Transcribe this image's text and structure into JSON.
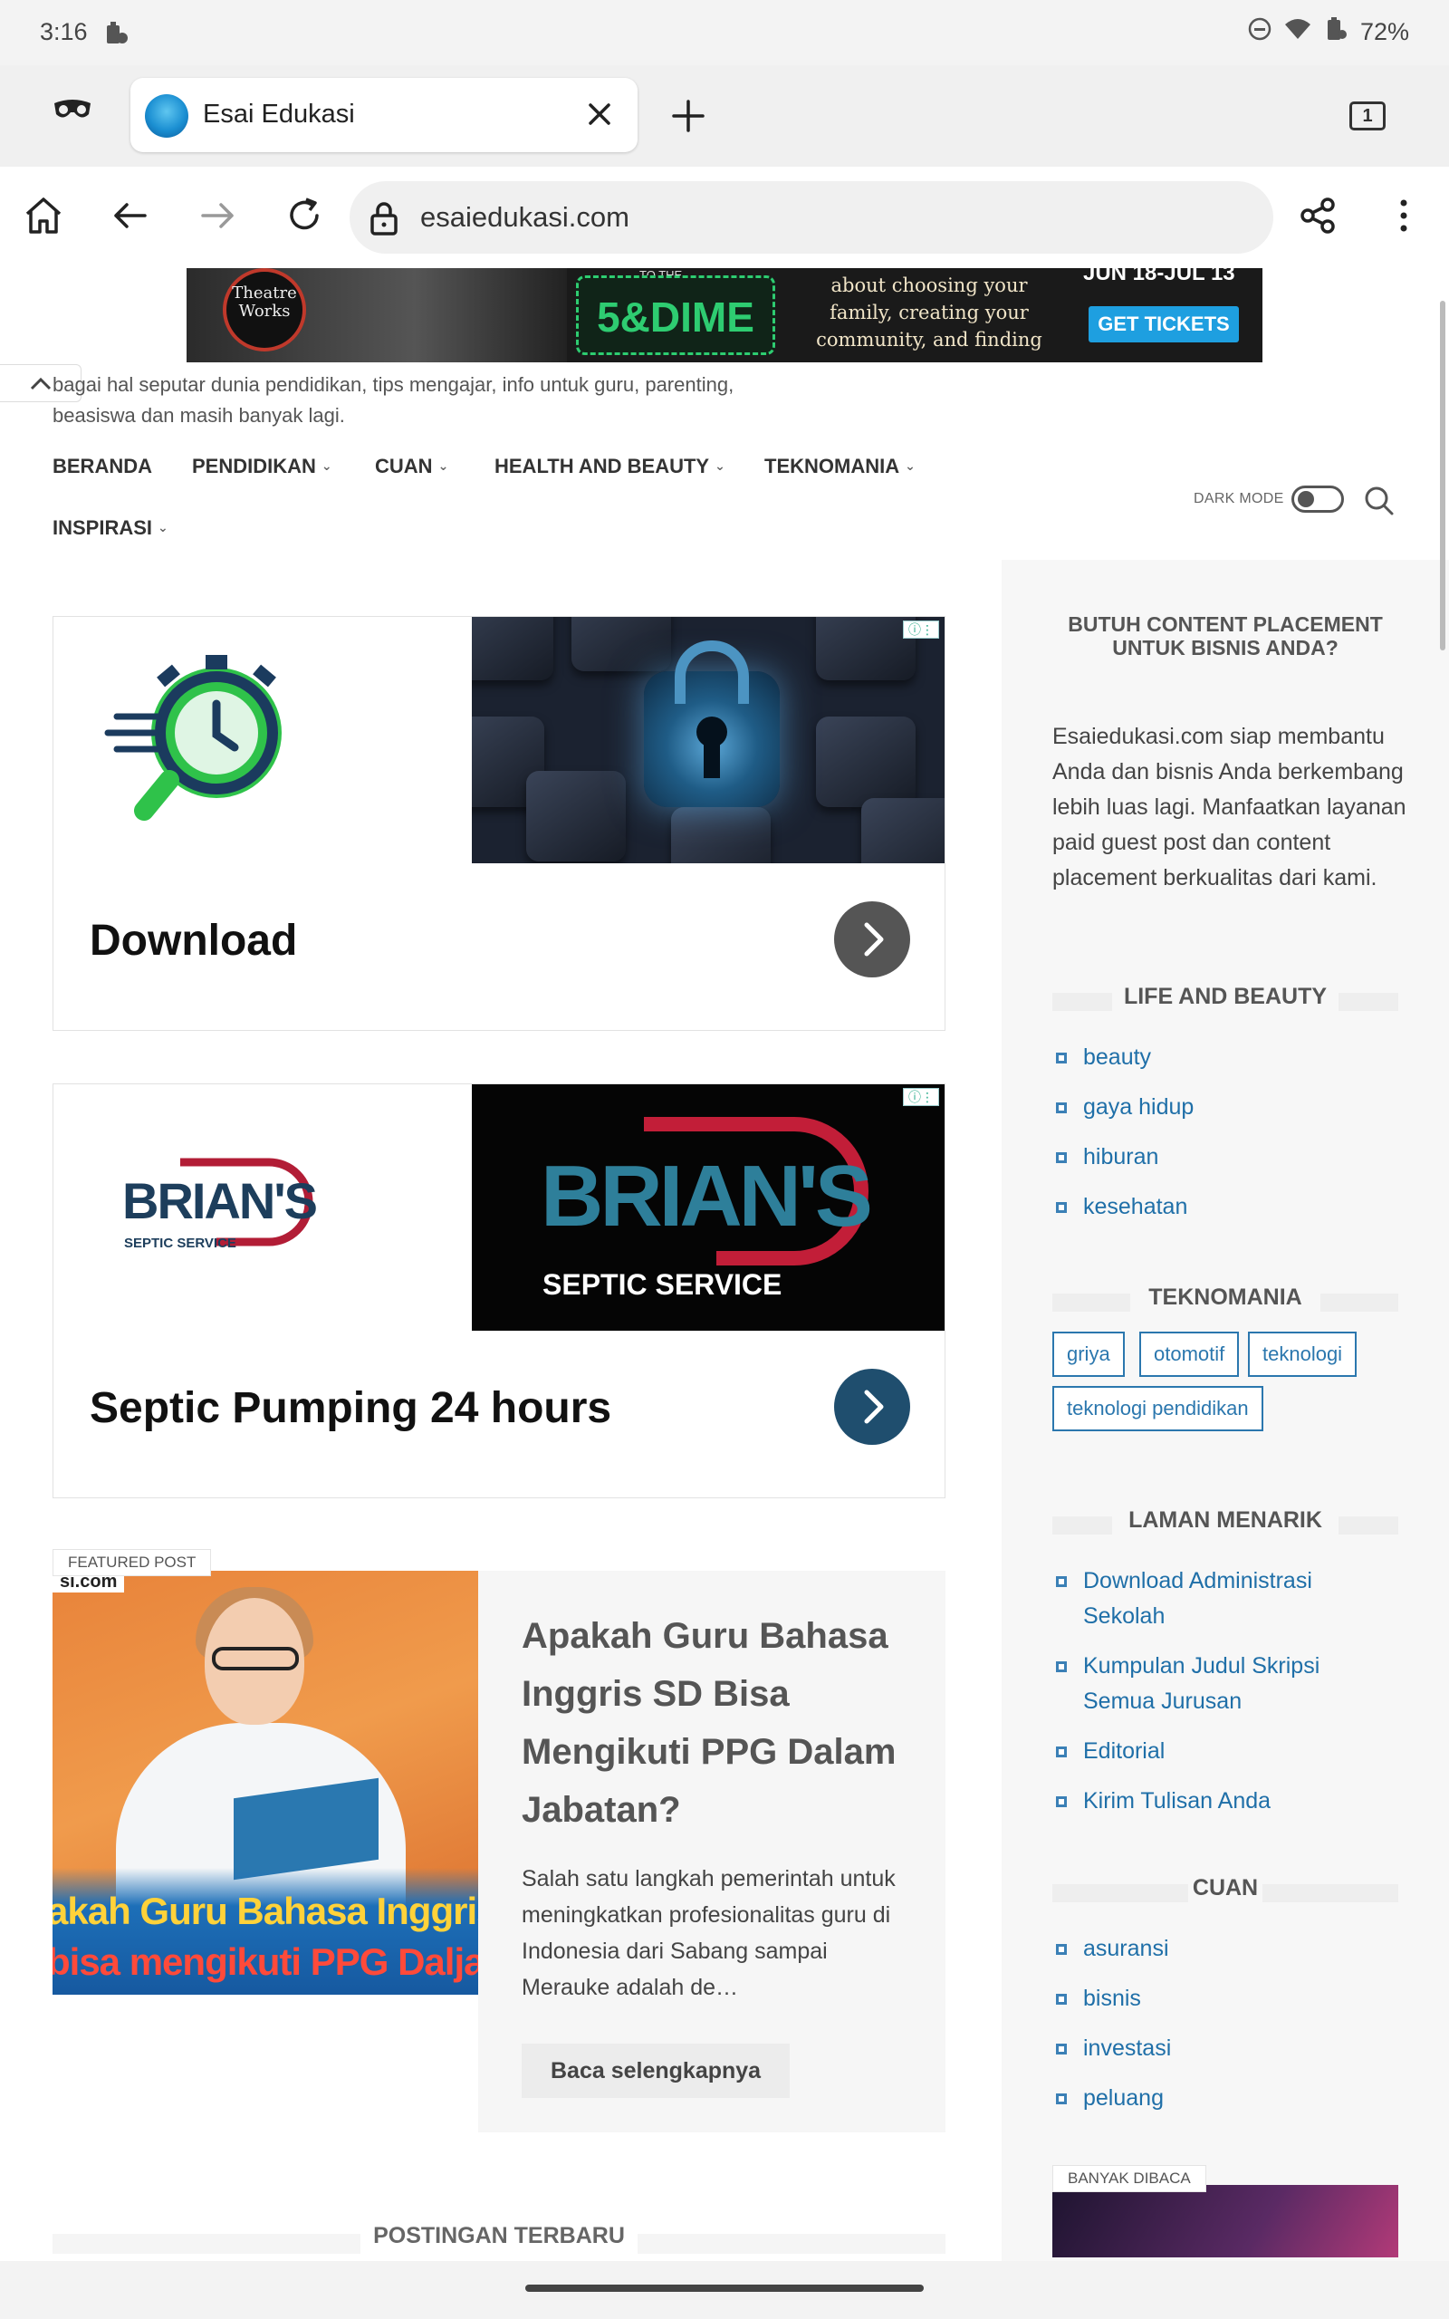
{
  "status_bar": {
    "time": "3:16",
    "battery": "72%"
  },
  "tab": {
    "title": "Esai Edukasi",
    "count": "1"
  },
  "address_bar": {
    "url": "esaiedukasi.com"
  },
  "banner_ad": {
    "theatre": "Theatre Works",
    "dime_top": "TO THE",
    "dime": "5&DIME",
    "message": "about choosing your family, creating your community, and finding your way",
    "dates": "JUN 18-JUL 13",
    "button": "GET TICKETS"
  },
  "site": {
    "tagline": "bagai hal seputar dunia pendidikan, tips mengajar, info untuk guru, parenting, beasiswa dan masih banyak lagi.",
    "dark_mode_label": "DARK MODE"
  },
  "nav": [
    {
      "label": "BERANDA",
      "has_dropdown": false
    },
    {
      "label": "PENDIDIKAN",
      "has_dropdown": true
    },
    {
      "label": "CUAN",
      "has_dropdown": true
    },
    {
      "label": "HEALTH AND BEAUTY",
      "has_dropdown": true
    },
    {
      "label": "TEKNOMANIA",
      "has_dropdown": true
    },
    {
      "label": "INSPIRASI",
      "has_dropdown": true
    }
  ],
  "ads": [
    {
      "headline": "Download",
      "arrow_color": "#555555"
    },
    {
      "headline": "Septic Pumping 24 hours",
      "arrow_color": "#1f4e6e",
      "brand": "BRIAN'S",
      "brand_sub": "SEPTIC SERVICE"
    }
  ],
  "featured": {
    "label": "FEATURED POST",
    "image_brand": "si.com",
    "image_line1": "akah Guru Bahasa Inggris",
    "image_line2": "bisa mengikuti PPG Dalja",
    "title": "Apakah Guru Bahasa Inggris SD Bisa Mengikuti PPG Dalam Jabatan?",
    "excerpt": "Salah satu langkah pemerintah untuk meningkatkan profesionalitas guru di Indonesia dari Sabang sampai Merauke adalah de…",
    "read_more": "Baca selengkapnya"
  },
  "latest_heading": "POSTINGAN TERBARU",
  "sidebar": {
    "promo_title": "BUTUH CONTENT PLACEMENT UNTUK BISNIS ANDA?",
    "promo_text": "Esaiedukasi.com siap membantu Anda dan bisnis Anda berkembang lebih luas lagi. Manfaatkan layanan paid guest post dan content placement berkualitas dari kami.",
    "life_heading": "LIFE AND BEAUTY",
    "life_items": [
      "beauty",
      "gaya hidup",
      "hiburan",
      "kesehatan"
    ],
    "tekno_heading": "TEKNOMANIA",
    "tekno_tags": [
      "griya",
      "otomotif",
      "teknologi",
      "teknologi pendidikan"
    ],
    "laman_heading": "LAMAN MENARIK",
    "laman_items": [
      "Download Administrasi Sekolah",
      "Kumpulan Judul Skripsi Semua Jurusan",
      "Editorial",
      "Kirim Tulisan Anda"
    ],
    "cuan_heading": "CUAN",
    "cuan_items": [
      "asuransi",
      "bisnis",
      "investasi",
      "peluang"
    ],
    "banyak_label": "BANYAK DIBACA"
  },
  "colors": {
    "link": "#1f6fa8",
    "accent": "#2b77ae"
  }
}
